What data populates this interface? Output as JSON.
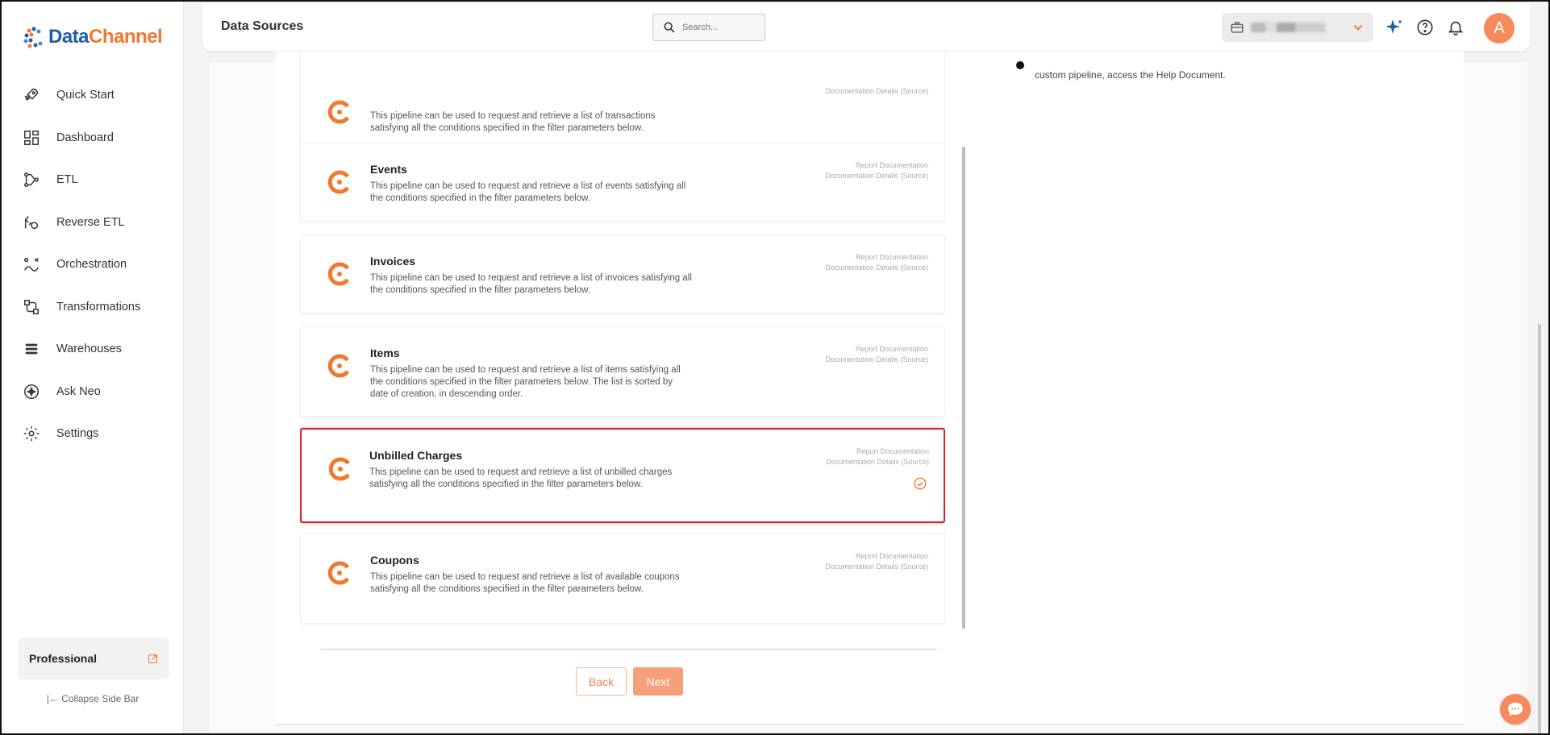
{
  "brand": {
    "logo_text_1": "Data",
    "logo_text_2": "Channel"
  },
  "sidebar": {
    "items": [
      {
        "label": "Quick Start",
        "icon": "rocket-icon"
      },
      {
        "label": "Dashboard",
        "icon": "dashboard-icon"
      },
      {
        "label": "ETL",
        "icon": "etl-icon"
      },
      {
        "label": "Reverse ETL",
        "icon": "reverse-etl-icon"
      },
      {
        "label": "Orchestration",
        "icon": "orchestration-icon"
      },
      {
        "label": "Transformations",
        "icon": "transformations-icon"
      },
      {
        "label": "Warehouses",
        "icon": "warehouses-icon"
      },
      {
        "label": "Ask Neo",
        "icon": "ask-neo-icon"
      },
      {
        "label": "Settings",
        "icon": "gear-icon"
      }
    ],
    "plan_label": "Professional",
    "collapse_label": "Collapse Side Bar"
  },
  "header": {
    "title": "Data Sources",
    "search_placeholder": "Search...",
    "avatar_letter": "A"
  },
  "right_panel": {
    "help_text": "custom pipeline, access the Help Document."
  },
  "pipelines": [
    {
      "title": "",
      "desc": "This pipeline can be used to request and retrieve a list of transactions satisfying all the conditions specified in the filter parameters below.",
      "link1": "",
      "link2": "Documentation Details (Source)",
      "selected": false
    },
    {
      "title": "Events",
      "desc": "This pipeline can be used to request and retrieve a list of events satisfying all the conditions specified in the filter parameters below.",
      "link1": "Report Documentation",
      "link2": "Documentation Details (Source)",
      "selected": false
    },
    {
      "title": "Invoices",
      "desc": "This pipeline can be used to request and retrieve a list of invoices satisfying all the conditions specified in the filter parameters below.",
      "link1": "Report Documentation",
      "link2": "Documentation Details (Source)",
      "selected": false
    },
    {
      "title": "Items",
      "desc": "This pipeline can be used to request and retrieve a list of items satisfying all the conditions specified in the filter parameters below. The list is sorted by date of creation, in descending order.",
      "link1": "Report Documentation",
      "link2": "Documentation Details (Source)",
      "selected": false
    },
    {
      "title": "Unbilled Charges",
      "desc": "This pipeline can be used to request and retrieve a list of unbilled charges satisfying all the conditions specified in the filter parameters below.",
      "link1": "Report Documentation",
      "link2": "Documentation Details (Source)",
      "selected": true
    },
    {
      "title": "Coupons",
      "desc": "This pipeline can be used to request and retrieve a list of available coupons satisfying all the conditions specified in the filter parameters below.",
      "link1": "Report Documentation",
      "link2": "Documentation Details (Source)",
      "selected": false
    }
  ],
  "actions": {
    "back_label": "Back",
    "next_label": "Next"
  },
  "colors": {
    "accent": "#f0782f",
    "selected_border": "#d81f26",
    "brand_blue": "#1f5fa8"
  }
}
